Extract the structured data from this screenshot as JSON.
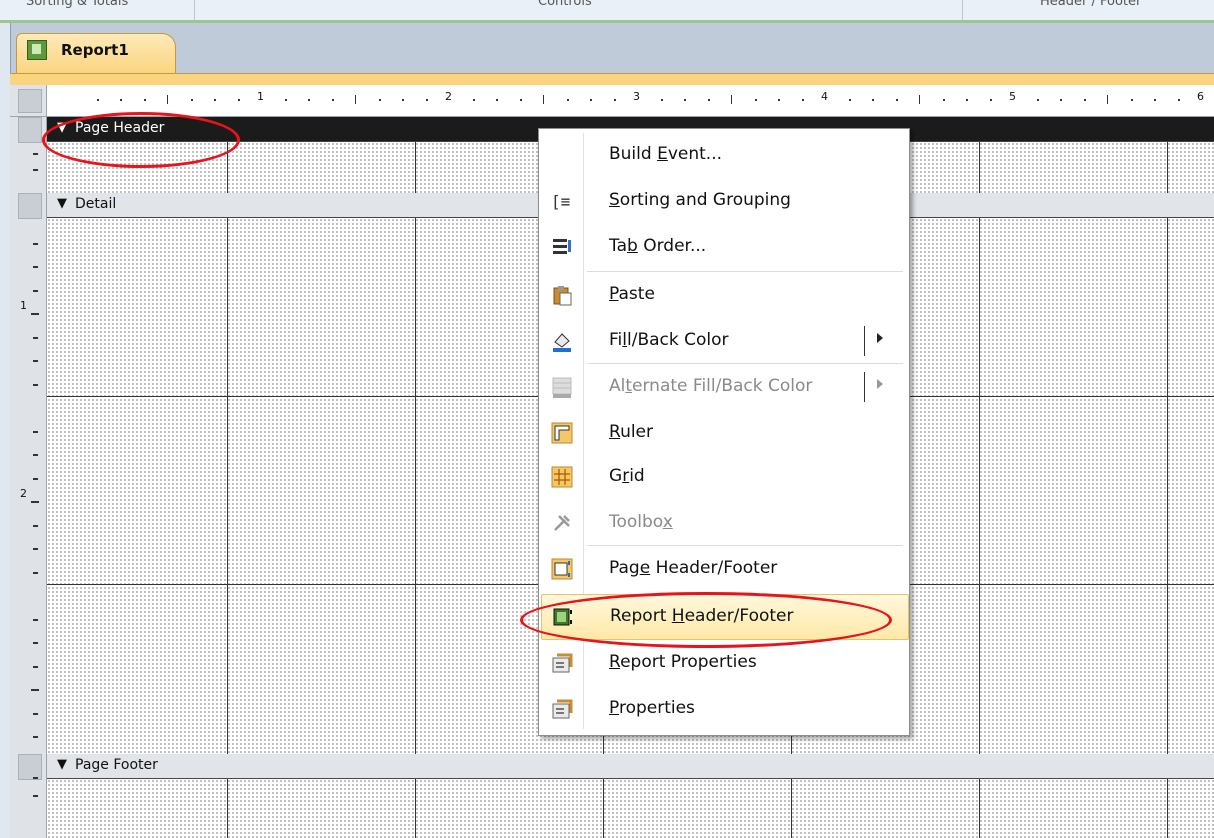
{
  "ribbon": {
    "groups": [
      "Sorting & Totals",
      "Controls",
      "Header / Footer"
    ]
  },
  "document_tab": {
    "label": "Report1",
    "icon": "report-icon"
  },
  "ruler": {
    "horizontal_numbers": [
      "1",
      "2",
      "3",
      "4",
      "5",
      "6"
    ],
    "vertical_numbers": [
      "1",
      "2"
    ]
  },
  "sections": {
    "page_header": "Page Header",
    "detail": "Detail",
    "page_footer": "Page Footer"
  },
  "context_menu": {
    "items": [
      {
        "pre": "Build ",
        "key": "E",
        "post": "vent...",
        "icon": "none",
        "enabled": true
      },
      {
        "pre": "",
        "key": "S",
        "post": "orting and Grouping",
        "icon": "sorting-grouping-icon",
        "enabled": true
      },
      {
        "pre": "Ta",
        "key": "b",
        "post": " Order...",
        "icon": "tab-order-icon",
        "enabled": true
      },
      {
        "pre": "",
        "key": "P",
        "post": "aste",
        "icon": "paste-icon",
        "enabled": true
      },
      {
        "pre": "Fi",
        "key": "l",
        "post": "l/Back Color",
        "icon": "fill-color-icon",
        "enabled": true,
        "submenu": true
      },
      {
        "pre": "Al",
        "key": "t",
        "post": "ernate Fill/Back Color",
        "icon": "alternate-fill-icon",
        "enabled": false,
        "submenu": true
      },
      {
        "pre": "",
        "key": "R",
        "post": "uler",
        "icon": "ruler-icon",
        "enabled": true
      },
      {
        "pre": "G",
        "key": "r",
        "post": "id",
        "icon": "grid-icon",
        "enabled": true
      },
      {
        "pre": "Toolbo",
        "key": "x",
        "post": "",
        "icon": "toolbox-icon",
        "enabled": false
      },
      {
        "pre": "Pag",
        "key": "e",
        "post": " Header/Footer",
        "icon": "page-header-footer-icon",
        "enabled": true
      },
      {
        "pre": "Report ",
        "key": "H",
        "post": "eader/Footer",
        "icon": "report-header-footer-icon",
        "enabled": true,
        "highlighted": true
      },
      {
        "pre": "",
        "key": "R",
        "post": "eport Properties",
        "icon": "report-properties-icon",
        "enabled": true
      },
      {
        "pre": "",
        "key": "P",
        "post": "roperties",
        "icon": "properties-icon",
        "enabled": true
      }
    ]
  },
  "colors": {
    "annotation_ring": "#e8141b",
    "tab_gold": "#fbd47f",
    "menu_highlight": "#ffe9a8"
  }
}
